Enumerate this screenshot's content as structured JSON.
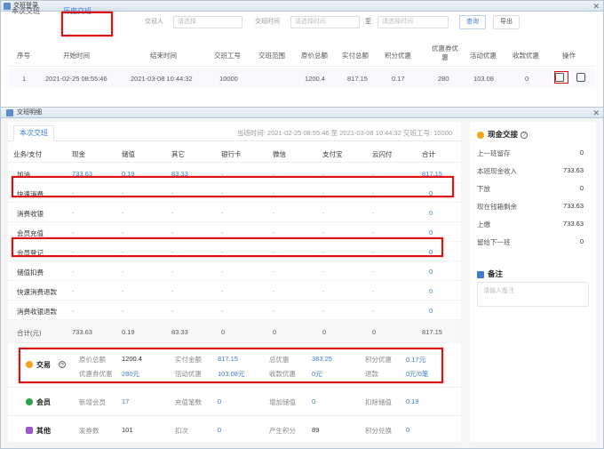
{
  "back_window": {
    "title": "交班登录",
    "close": "✕",
    "tabs": [
      "本次交班",
      "历史交班"
    ],
    "filters": {
      "shift_person_label": "交班人",
      "shift_person_placeholder": "请选择",
      "shift_time_label": "交班时间",
      "start_placeholder": "请选择时间",
      "to": "至",
      "end_placeholder": "请选择时间",
      "query": "查询",
      "export": "导出"
    },
    "headers": [
      "序号",
      "开始时间",
      "结束时间",
      "交班工号",
      "交班范围",
      "原价总额",
      "实付总额",
      "积分优惠",
      "优惠券优惠",
      "活动优惠",
      "收款优惠",
      "操作"
    ],
    "row": [
      "1",
      "2021-02-25 08:55:46",
      "2021-03-08 10:44:32",
      "10000",
      "",
      "1200.4",
      "817.15",
      "0.17",
      "280",
      "103.08",
      "0"
    ]
  },
  "front_window": {
    "title": "交班明细",
    "close": "✕",
    "tab": "本次交班",
    "info": "当班时间: 2021-02-25 08:55:46 至 2021-03-08 10:44:32   交班工号: 10000",
    "grid": {
      "headers": [
        "业务/支付",
        "现金",
        "储值",
        "其它",
        "银行卡",
        "微信",
        "支付宝",
        "云闪付",
        "合计"
      ],
      "rows": [
        [
          "加油",
          "733.63",
          "0.19",
          "83.33",
          "-",
          "-",
          "-",
          "-",
          "817.15"
        ],
        [
          "快速消费",
          "-",
          "-",
          "-",
          "-",
          "-",
          "-",
          "-",
          "0"
        ],
        [
          "消费收银",
          "-",
          "-",
          "-",
          "-",
          "-",
          "-",
          "-",
          "0"
        ],
        [
          "会员充值",
          "-",
          "-",
          "-",
          "-",
          "-",
          "-",
          "-",
          "0"
        ],
        [
          "会员登记",
          "-",
          "-",
          "-",
          "-",
          "-",
          "-",
          "-",
          "0"
        ],
        [
          "储值扣费",
          "-",
          "-",
          "-",
          "-",
          "-",
          "-",
          "-",
          "0"
        ],
        [
          "快速消费退款",
          "-",
          "-",
          "-",
          "-",
          "-",
          "-",
          "-",
          "0"
        ],
        [
          "消费收银退款",
          "-",
          "-",
          "-",
          "-",
          "-",
          "-",
          "-",
          "0"
        ]
      ],
      "total": [
        "合计(元)",
        "733.63",
        "0.19",
        "83.33",
        "0",
        "0",
        "0",
        "0",
        "817.15"
      ]
    },
    "cash_handover": {
      "title": "现金交接",
      "items": [
        {
          "label": "上一班留存",
          "value": "0"
        },
        {
          "label": "本班现金收入",
          "value": "733.63"
        },
        {
          "label": "下放",
          "value": "0"
        },
        {
          "label": "现在钱箱剩余",
          "value": "733.63"
        },
        {
          "label": "上缴",
          "value": "733.63"
        },
        {
          "label": "留给下一班",
          "value": "0"
        }
      ]
    },
    "notes": {
      "title": "备注",
      "placeholder": "请输入备注"
    },
    "summary": {
      "trade": {
        "title": "交易",
        "r1": [
          [
            "原价总额",
            "1200.4"
          ],
          [
            "实付金额",
            "817.15"
          ],
          [
            "总优惠",
            "383.25"
          ],
          [
            "积分优惠",
            "0.17元"
          ]
        ],
        "r2": [
          [
            "优惠券优惠",
            "280元"
          ],
          [
            "活动优惠",
            "103.08元"
          ],
          [
            "收款优惠",
            "0元"
          ],
          [
            "退款",
            "0元/0笔"
          ]
        ]
      },
      "member": {
        "title": "会员",
        "r1": [
          [
            "新增会员",
            "17"
          ],
          [
            "充值笔数",
            "0"
          ],
          [
            "增加储值",
            "0"
          ],
          [
            "扣除储值",
            "0.19"
          ]
        ]
      },
      "other": {
        "title": "其他",
        "r1": [
          [
            "发券数",
            "101"
          ],
          [
            "扣次",
            "0"
          ],
          [
            "产生积分",
            "89"
          ],
          [
            "积分兑换",
            "0"
          ]
        ]
      }
    }
  }
}
